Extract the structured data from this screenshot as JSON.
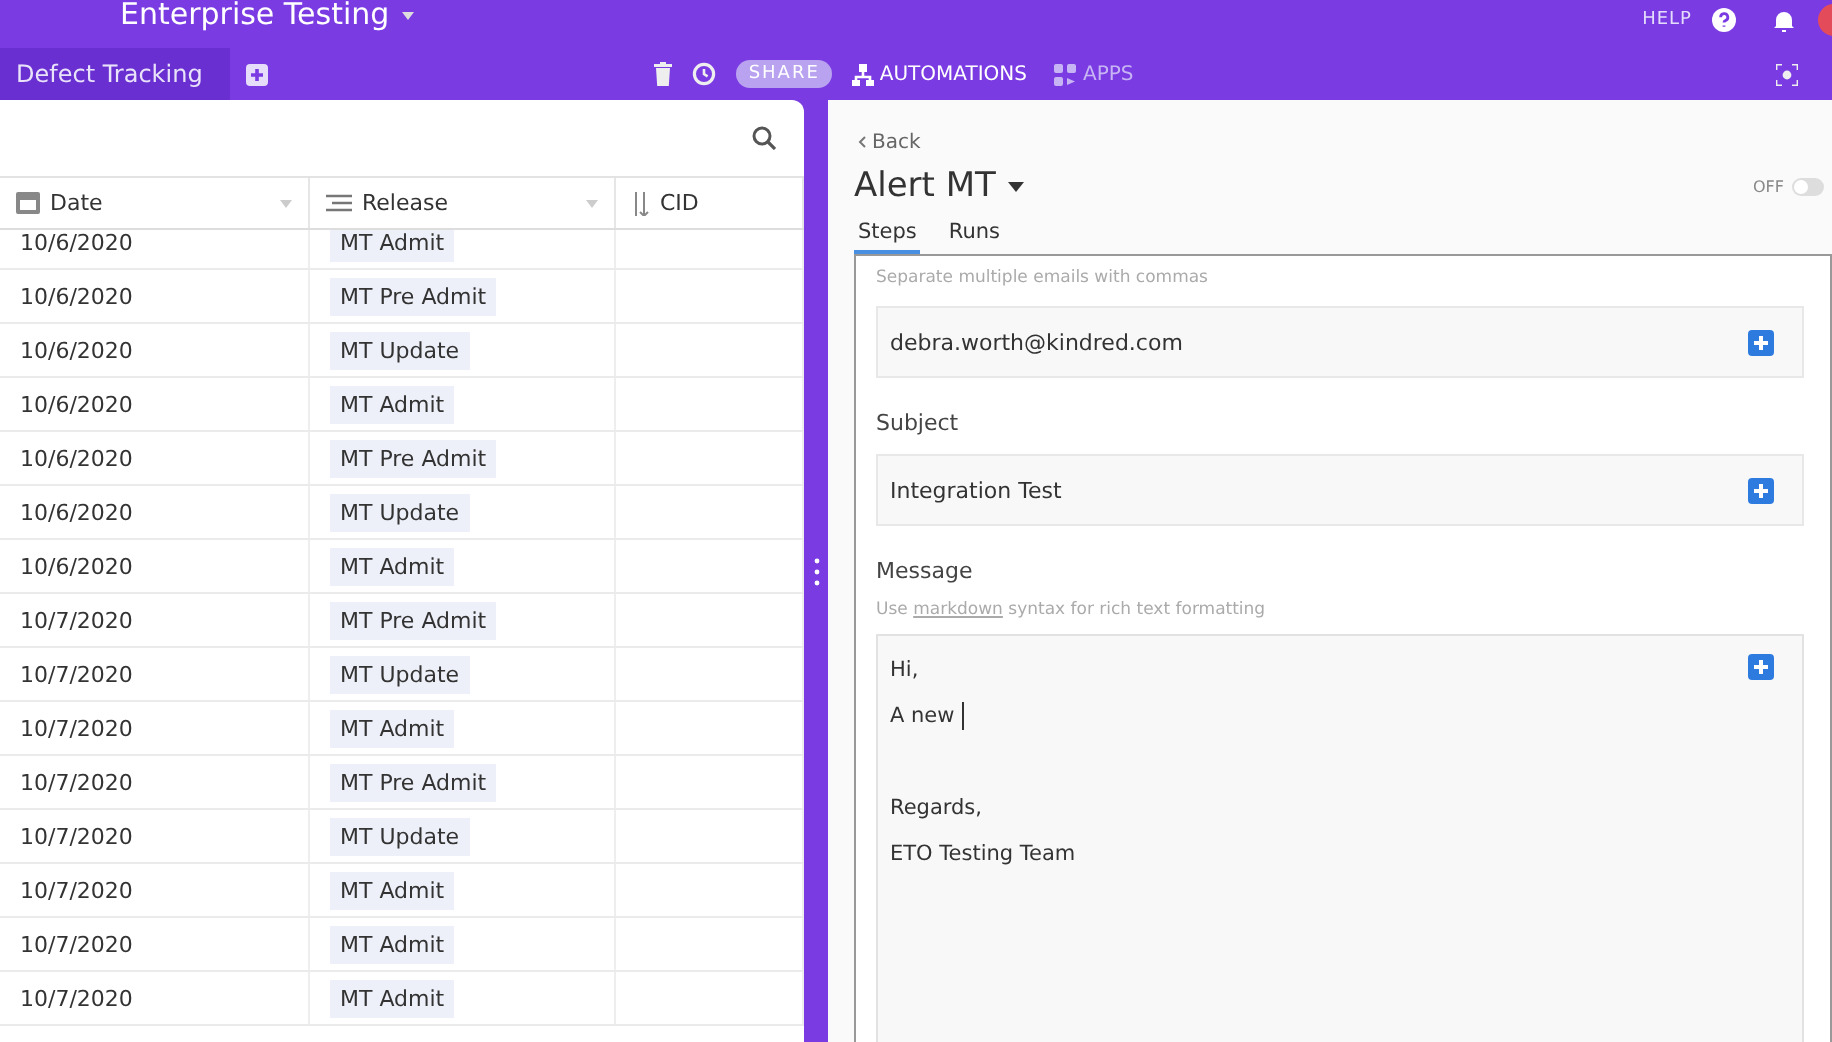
{
  "workspace": {
    "title": "Enterprise Testing",
    "help": "HELP"
  },
  "toolbar": {
    "view_tab": "Defect Tracking",
    "share": "SHARE",
    "automations": "AUTOMATIONS",
    "apps": "APPS"
  },
  "table": {
    "columns": [
      {
        "label": "Date",
        "kind": "date"
      },
      {
        "label": "Release",
        "kind": "select"
      },
      {
        "label": "CID",
        "kind": "number"
      }
    ],
    "rows": [
      {
        "date": "10/6/2020",
        "release": "MT Admit"
      },
      {
        "date": "10/6/2020",
        "release": "MT Pre Admit"
      },
      {
        "date": "10/6/2020",
        "release": "MT Update"
      },
      {
        "date": "10/6/2020",
        "release": "MT Admit"
      },
      {
        "date": "10/6/2020",
        "release": "MT Pre Admit"
      },
      {
        "date": "10/6/2020",
        "release": "MT Update"
      },
      {
        "date": "10/6/2020",
        "release": "MT Admit"
      },
      {
        "date": "10/7/2020",
        "release": "MT Pre Admit"
      },
      {
        "date": "10/7/2020",
        "release": "MT Update"
      },
      {
        "date": "10/7/2020",
        "release": "MT Admit"
      },
      {
        "date": "10/7/2020",
        "release": "MT Pre Admit"
      },
      {
        "date": "10/7/2020",
        "release": "MT Update"
      },
      {
        "date": "10/7/2020",
        "release": "MT Admit"
      },
      {
        "date": "10/7/2020",
        "release": "MT Admit"
      },
      {
        "date": "10/7/2020",
        "release": "MT Admit"
      }
    ]
  },
  "automation": {
    "back": "Back",
    "title": "Alert MT",
    "toggle": {
      "label": "OFF",
      "on": false
    },
    "tabs": [
      {
        "label": "Steps",
        "selected": true
      },
      {
        "label": "Runs",
        "selected": false
      }
    ],
    "email_hint": "Separate multiple emails with commas",
    "to": "debra.worth@kindred.com",
    "subject_label": "Subject",
    "subject": "Integration Test",
    "message_label": "Message",
    "message_hint": "Use **markdown** syntax for rich text formatting",
    "message_blocks": [
      [
        "Hi,",
        "A new "
      ],
      [
        "Regards,",
        "ETO Testing Team"
      ]
    ]
  }
}
